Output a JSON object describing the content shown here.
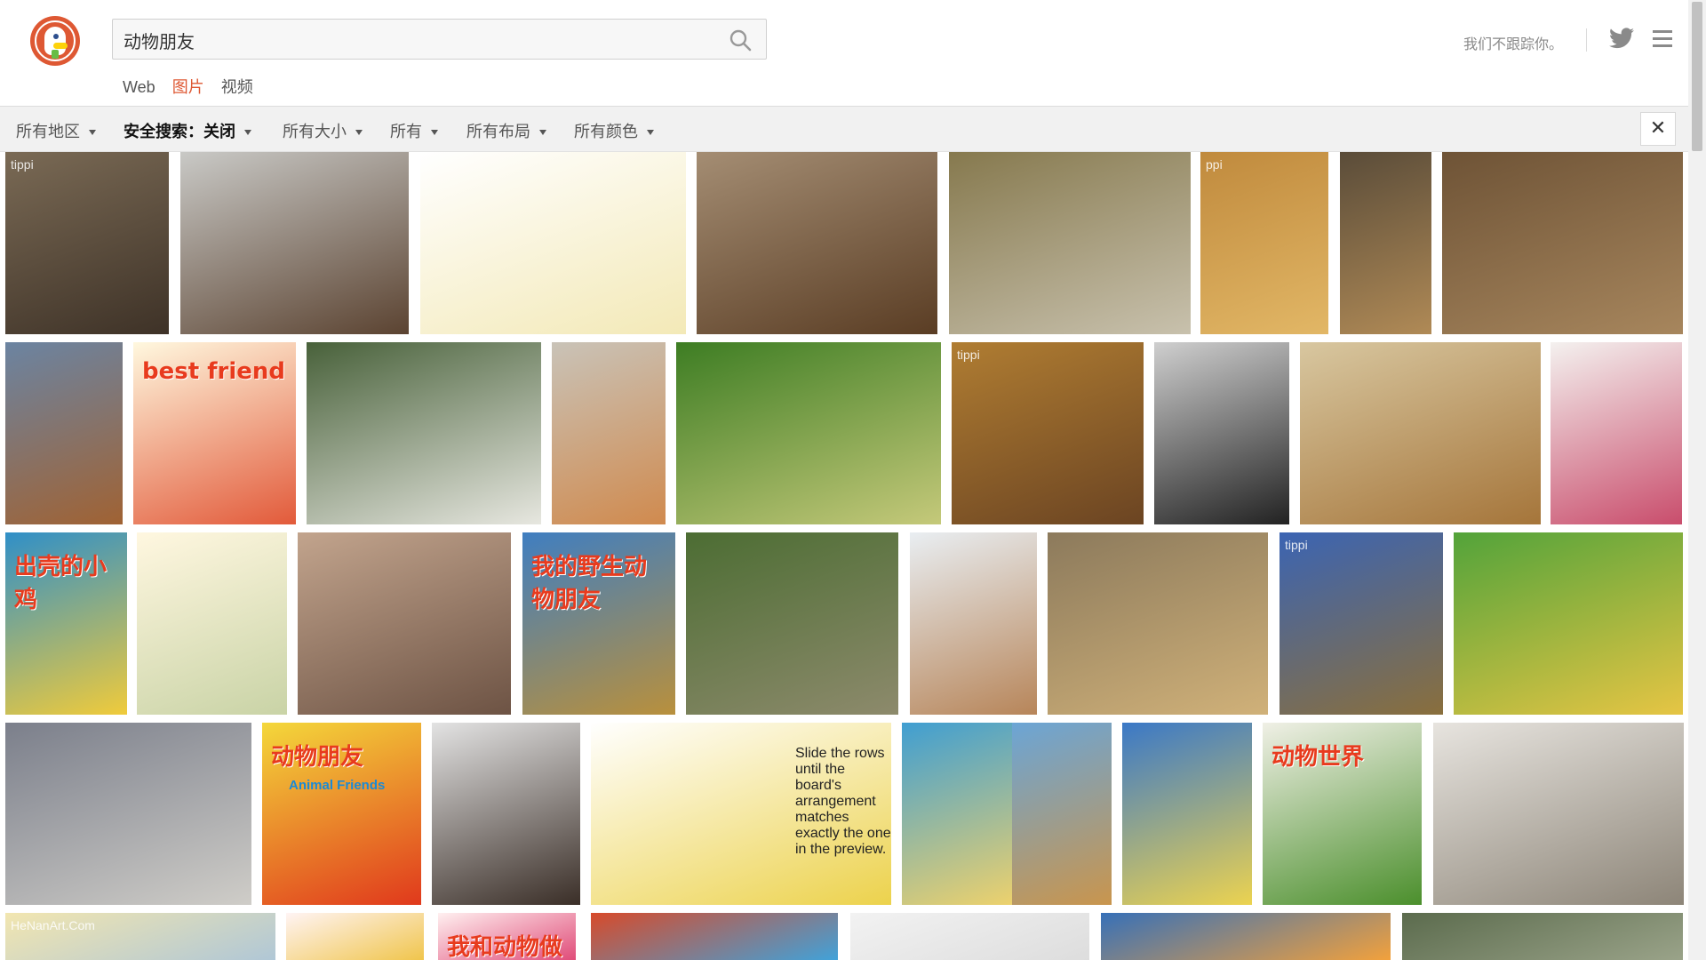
{
  "search": {
    "query": "动物朋友"
  },
  "tabs": [
    {
      "label": "Web",
      "active": false
    },
    {
      "label": "图片",
      "active": true
    },
    {
      "label": "视频",
      "active": false
    }
  ],
  "tagline": "我们不跟踪你。",
  "filters": [
    {
      "label": "所有地区"
    },
    {
      "label": "安全搜索：关闭"
    },
    {
      "label": "所有大小"
    },
    {
      "label": "所有"
    },
    {
      "label": "所有布局"
    },
    {
      "label": "所有颜色"
    }
  ],
  "close_label": "✕",
  "colors": {
    "accent": "#de5833",
    "filter_bg": "#f1f1f1"
  },
  "tiles": [
    {
      "subject": "elephant and child",
      "label": "tippi",
      "colors": [
        "#7a6a55",
        "#3e3227"
      ]
    },
    {
      "subject": "two bears playing",
      "colors": [
        "#c9c9c6",
        "#5b4331"
      ]
    },
    {
      "subject": "cartoon animals",
      "colors": [
        "#ffffff",
        "#f3e9b7"
      ]
    },
    {
      "subject": "kittens",
      "colors": [
        "#a48d73",
        "#5a3d24"
      ]
    },
    {
      "subject": "lambs on sheep",
      "colors": [
        "#86794e",
        "#c8c1ad"
      ]
    },
    {
      "subject": "girl with lion cub",
      "label": "ppi",
      "colors": [
        "#c08a3d",
        "#e2b766"
      ]
    },
    {
      "subject": "lion cubs",
      "colors": [
        "#5a4c39",
        "#b08a56"
      ]
    },
    {
      "subject": "girl with cubs",
      "colors": [
        "#6e5336",
        "#a7865d"
      ]
    },
    {
      "subject": "dogs",
      "colors": [
        "#6b84a2",
        "#a06233"
      ]
    },
    {
      "subject": "best friend cartoon",
      "title": "best friend",
      "colors": [
        "#fff8df",
        "#e25a3a"
      ]
    },
    {
      "subject": "panda cubs in basket",
      "colors": [
        "#48613a",
        "#e7e7e0"
      ]
    },
    {
      "subject": "kittens hugging",
      "colors": [
        "#c9c3b8",
        "#d08a4e"
      ]
    },
    {
      "subject": "goslings",
      "colors": [
        "#3d7d23",
        "#c5c97a"
      ]
    },
    {
      "subject": "girl with frog",
      "label": "tippi",
      "colors": [
        "#b07d32",
        "#6b4422"
      ]
    },
    {
      "subject": "woman with dog",
      "colors": [
        "#cfcfcf",
        "#222222"
      ]
    },
    {
      "subject": "girl with leopard",
      "colors": [
        "#d8c7a0",
        "#a5753a"
      ]
    },
    {
      "subject": "game screens",
      "colors": [
        "#f4f1ef",
        "#c94d6c"
      ]
    },
    {
      "subject": "chick book cover",
      "title": "出壳的小鸡",
      "colors": [
        "#2f8fc8",
        "#f0cb3b"
      ]
    },
    {
      "subject": "cartoon dog and friends",
      "colors": [
        "#fff7e0",
        "#c9d3a6"
      ]
    },
    {
      "subject": "meerkats",
      "colors": [
        "#c2a48d",
        "#6d5344"
      ]
    },
    {
      "subject": "wild friends book",
      "title": "我的野生动物朋友",
      "colors": [
        "#3f7ec1",
        "#b9903c"
      ]
    },
    {
      "subject": "baby elephant",
      "colors": [
        "#4c6d33",
        "#8d8a6c"
      ]
    },
    {
      "subject": "boy with snake",
      "colors": [
        "#e9eef2",
        "#b78559"
      ]
    },
    {
      "subject": "girl with cheetah",
      "colors": [
        "#8c7a5c",
        "#d0b179"
      ]
    },
    {
      "subject": "girl on ostrich",
      "label": "tippi",
      "colors": [
        "#3b64b3",
        "#8a6f3c"
      ]
    },
    {
      "subject": "kids drawing animals",
      "colors": [
        "#52a33a",
        "#e6c544"
      ]
    },
    {
      "subject": "horses",
      "colors": [
        "#7b7f8b",
        "#cfcdc8"
      ]
    },
    {
      "subject": "animal friends book",
      "title": "动物朋友",
      "sub": "Animal Friends",
      "colors": [
        "#f4d83b",
        "#e0391c"
      ]
    },
    {
      "subject": "puppy in snow",
      "colors": [
        "#e3e3e3",
        "#3a2e27"
      ]
    },
    {
      "subject": "game level",
      "note": "Slide the rows until the board's arrangement matches exactly the one in the preview.",
      "colors": [
        "#ffffff",
        "#ecd24c"
      ]
    },
    {
      "subject": "bento lunch",
      "colors": [
        "#3f9ed2",
        "#f2d36a"
      ]
    },
    {
      "subject": "giraffes",
      "colors": [
        "#6ba5d6",
        "#c9954d"
      ]
    },
    {
      "subject": "kids posters",
      "colors": [
        "#3a78c7",
        "#ecd350"
      ]
    },
    {
      "subject": "animal world book",
      "title": "动物世界",
      "colors": [
        "#f0f0e6",
        "#4b8f2c"
      ]
    },
    {
      "subject": "rabbits",
      "colors": [
        "#e7e4df",
        "#8d8578"
      ]
    },
    {
      "subject": "HeNanArt drawing",
      "label": "HeNanArt.Com",
      "colors": [
        "#f2e6b0",
        "#b0c7d6"
      ]
    },
    {
      "subject": "cartoon page",
      "colors": [
        "#fff4f4",
        "#f0c54c"
      ]
    },
    {
      "subject": "animal friends page",
      "title": "我和动物做朋友",
      "colors": [
        "#fff0f0",
        "#e04c79"
      ]
    },
    {
      "subject": "colorful painting",
      "colors": [
        "#d74a2a",
        "#41a2d9"
      ]
    },
    {
      "subject": "white puppy",
      "colors": [
        "#f2f2f2",
        "#dddddd"
      ]
    },
    {
      "subject": "sunset",
      "colors": [
        "#3670b8",
        "#f2a13c"
      ]
    },
    {
      "subject": "animals outdoors",
      "colors": [
        "#5b6b4d",
        "#9aa389"
      ]
    }
  ]
}
